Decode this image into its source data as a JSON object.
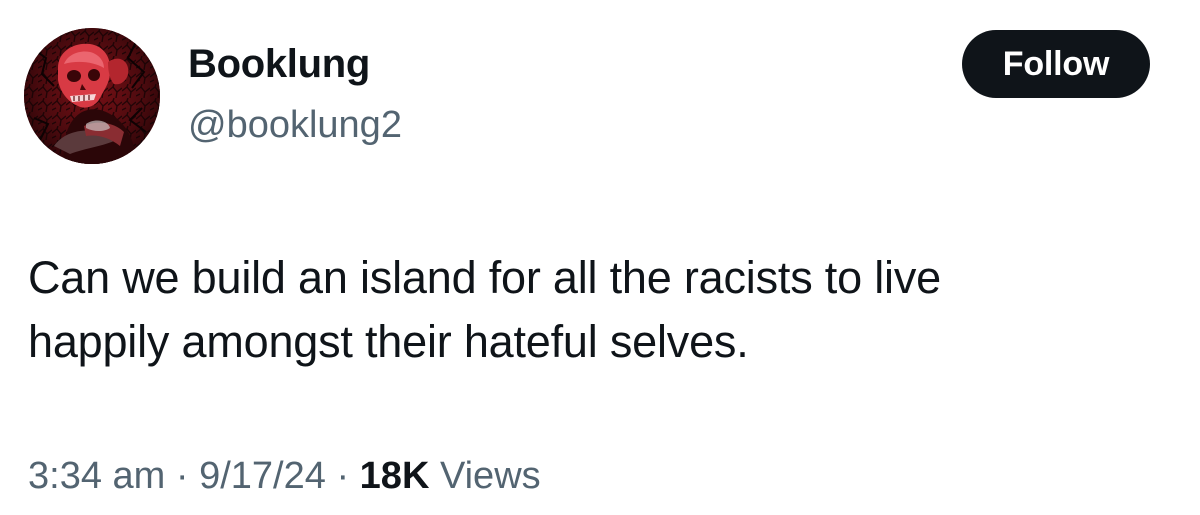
{
  "author": {
    "display_name": "Booklung",
    "handle": "@booklung2"
  },
  "follow_button": {
    "label": "Follow"
  },
  "tweet": {
    "text_lines": [
      "Can we build an island for all the racists to live",
      "happily amongst their hateful selves."
    ]
  },
  "meta": {
    "time": "3:34 am",
    "separator": "·",
    "date": "9/17/24",
    "views_count": "18K",
    "views_label": "Views"
  },
  "colors": {
    "text_primary": "#0f1419",
    "text_secondary": "#536471",
    "button_bg": "#0f1419",
    "button_text": "#ffffff",
    "avatar_accent": "#d0202a"
  }
}
